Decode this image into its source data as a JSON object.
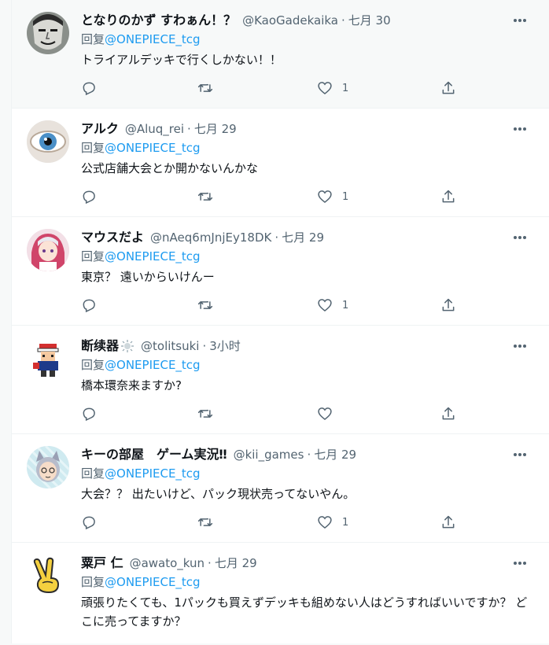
{
  "reply_prefix": "回复",
  "tweets": [
    {
      "name": "となりのかず すわぁん！？",
      "handle": "@KaoGadekaika",
      "time": "七月 30",
      "reply_to": "@ONEPIECE_tcg",
      "text": "トライアルデッキで行くしかない！！",
      "likes": "1",
      "avatar_icon": "manga-face-avatar"
    },
    {
      "name": "アルク",
      "handle": "@Aluq_rei",
      "time": "七月 29",
      "reply_to": "@ONEPIECE_tcg",
      "text": "公式店舗大会とか開かないんかな",
      "likes": "1",
      "avatar_icon": "eye-avatar"
    },
    {
      "name": "マウスだよ",
      "handle": "@nAeq6mJnjEy18DK",
      "time": "七月 29",
      "reply_to": "@ONEPIECE_tcg",
      "text": "東京？ 遠いからいけんー",
      "likes": "1",
      "avatar_icon": "anime-girl-avatar"
    },
    {
      "name": "断续器",
      "handle": "@tolitsuki",
      "time": "3小时",
      "reply_to": "@ONEPIECE_tcg",
      "text": "橋本環奈来ますか?",
      "likes": "",
      "avatar_icon": "pixel-character-avatar"
    },
    {
      "name": "キーの部屋　ゲーム実況‼",
      "handle": "@kii_games",
      "time": "七月 29",
      "reply_to": "@ONEPIECE_tcg",
      "text": "大会？？ 出たいけど、パック現状売ってないやん。",
      "likes": "1",
      "avatar_icon": "cat-ear-avatar"
    },
    {
      "name": "粟戸 仁",
      "handle": "@awato_kun",
      "time": "七月 29",
      "reply_to": "@ONEPIECE_tcg",
      "text": "頑張りたくても、1パックも買えずデッキも組めない人はどうすればいいですか？ どこに売ってますか？",
      "likes": "",
      "avatar_icon": "peace-hand-avatar"
    }
  ],
  "icons": {
    "reply": "reply-icon",
    "retweet": "retweet-icon",
    "like": "heart-icon",
    "share": "share-icon",
    "more": "more-icon"
  },
  "colors": {
    "link": "#1d9bf0",
    "secondary": "#536471",
    "text": "#0f1419",
    "border": "#eff3f4"
  }
}
